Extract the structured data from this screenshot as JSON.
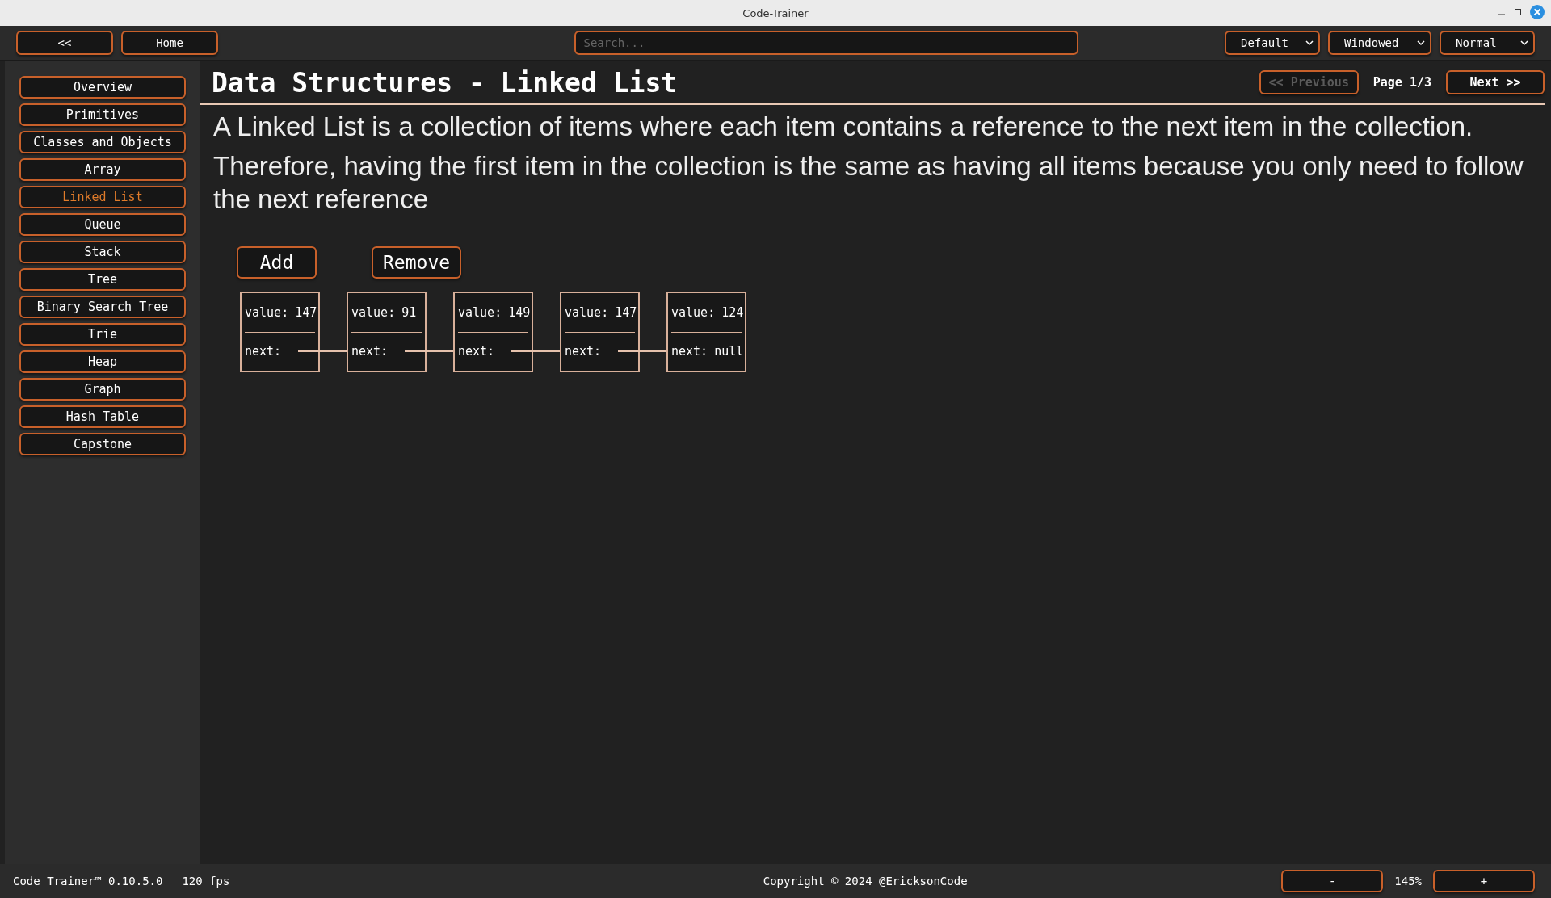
{
  "window": {
    "title": "Code-Trainer"
  },
  "toolbar": {
    "back": "<<",
    "home": "Home",
    "search": {
      "placeholder": "Search..."
    },
    "dropdowns": [
      {
        "value": "Default"
      },
      {
        "value": "Windowed"
      },
      {
        "value": "Normal"
      }
    ]
  },
  "sidebar": {
    "items": [
      {
        "label": "Overview",
        "selected": false
      },
      {
        "label": "Primitives",
        "selected": false
      },
      {
        "label": "Classes and Objects",
        "selected": false
      },
      {
        "label": "Array",
        "selected": false
      },
      {
        "label": "Linked List",
        "selected": true
      },
      {
        "label": "Queue",
        "selected": false
      },
      {
        "label": "Stack",
        "selected": false
      },
      {
        "label": "Tree",
        "selected": false
      },
      {
        "label": "Binary Search Tree",
        "selected": false
      },
      {
        "label": "Trie",
        "selected": false
      },
      {
        "label": "Heap",
        "selected": false
      },
      {
        "label": "Graph",
        "selected": false
      },
      {
        "label": "Hash Table",
        "selected": false
      },
      {
        "label": "Capstone",
        "selected": false
      }
    ]
  },
  "content": {
    "title": "Data Structures - Linked List",
    "pager": {
      "previous": {
        "label": "<< Previous",
        "disabled": true
      },
      "page": "Page 1/3",
      "next": {
        "label": "Next >>",
        "disabled": false
      }
    },
    "paragraphs": [
      "A Linked List is a collection of items where each item contains a reference to the next item in the collection.",
      "Therefore, having the first item in the collection is the same as having all items because you only need to follow the next reference"
    ],
    "actions": [
      "Add",
      "Remove"
    ],
    "nodes": [
      {
        "value_label": "value:",
        "value": "147",
        "next_label": "next:"
      },
      {
        "value_label": "value:",
        "value": "91",
        "next_label": "next:"
      },
      {
        "value_label": "value:",
        "value": "149",
        "next_label": "next:"
      },
      {
        "value_label": "value:",
        "value": "147",
        "next_label": "next:"
      },
      {
        "value_label": "value:",
        "value": "124",
        "next_label": "next:",
        "next": "null"
      }
    ]
  },
  "status_bar": {
    "version": "Code Trainer™ 0.10.5.0",
    "fps": "120 fps",
    "copyright": "Copyright © 2024 @EricksonCode",
    "zoom_out": "-",
    "zoom": "145%",
    "zoom_in": "+"
  }
}
